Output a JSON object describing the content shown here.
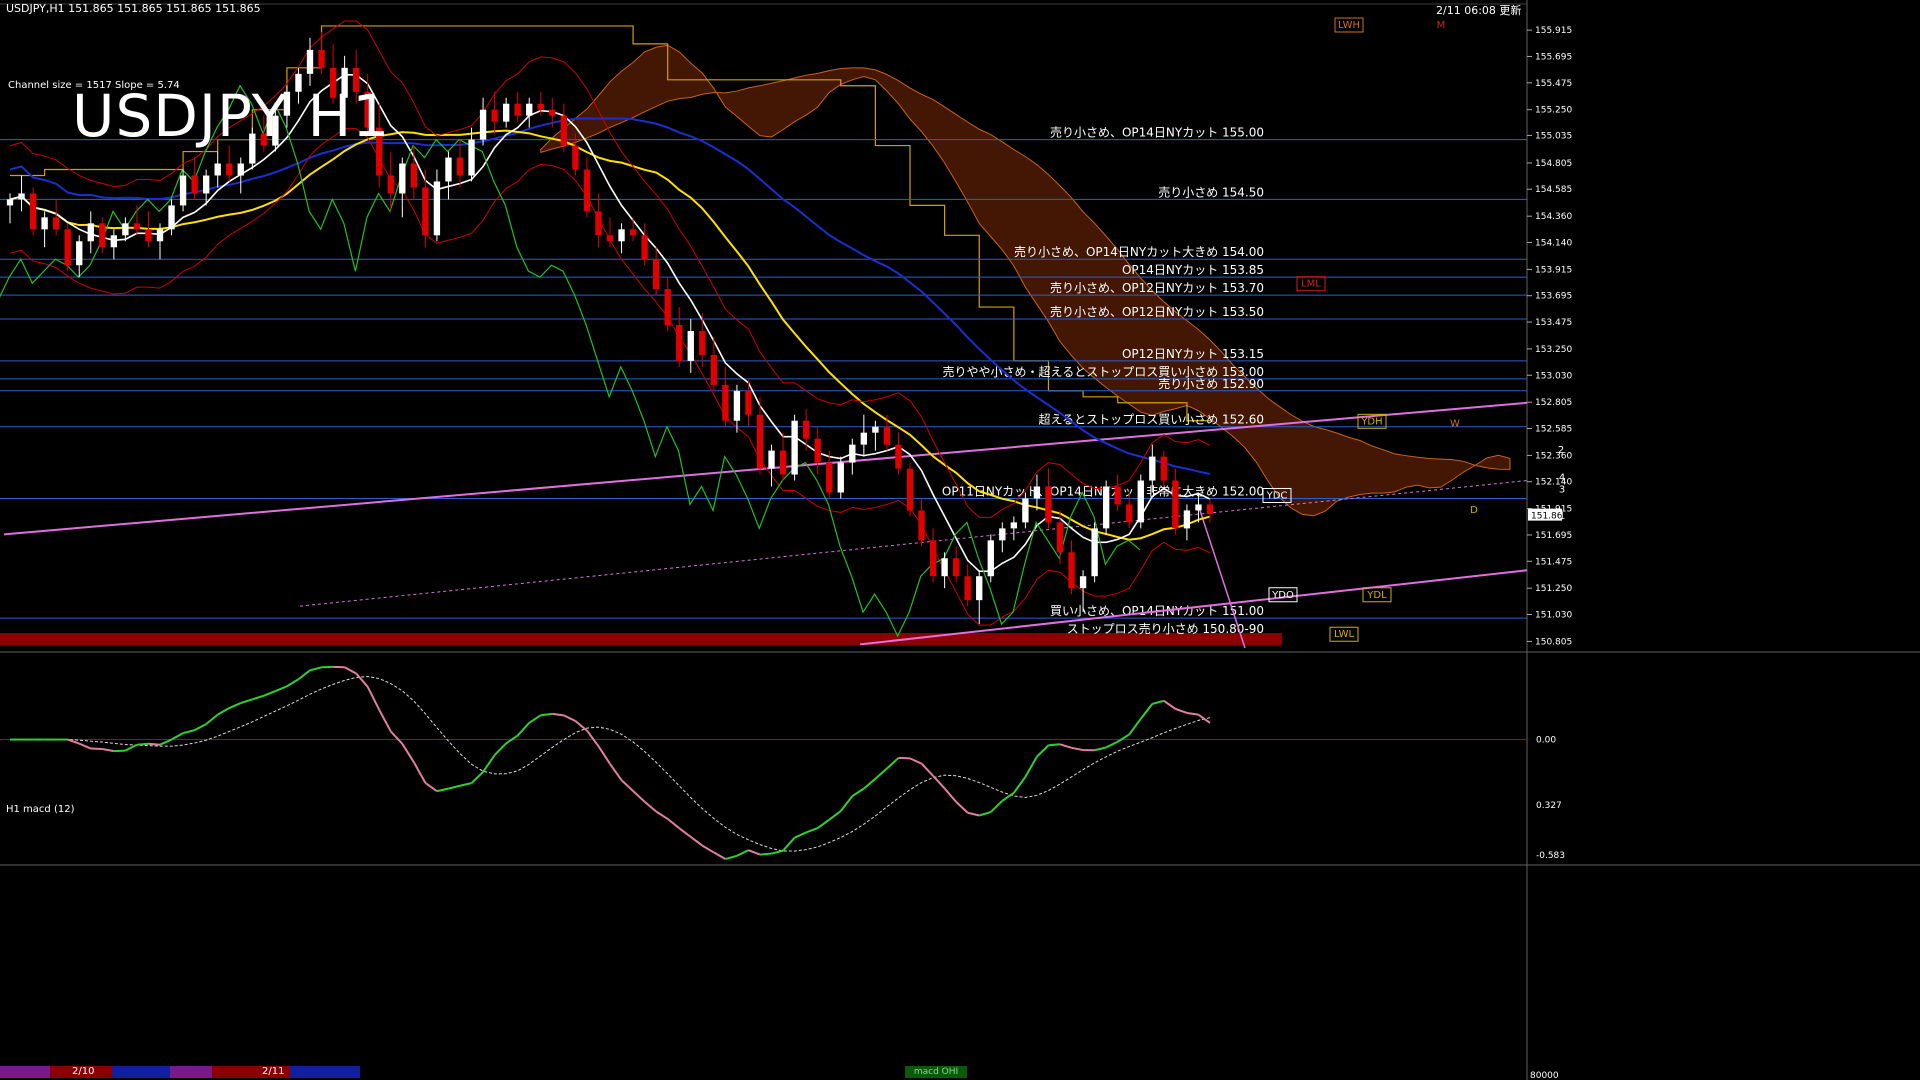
{
  "header": {
    "symbol_info": "USDJPY,H1  151.865 151.865 151.865 151.865",
    "datetime": "2/11 06:08",
    "suffix": "更新",
    "title": "USDJPY H1",
    "channel_info": "Channel size = 1517 Slope = 5.74"
  },
  "macd": {
    "label": "H1  macd (12)",
    "scale_top": "0.327",
    "scale_zero": "0.00",
    "scale_bottom": "-0.583",
    "volume_label": "80000"
  },
  "timeline": {
    "dates": [
      "2/10",
      "2/11"
    ],
    "tab_label": "macd OHI"
  },
  "colors": {
    "bull": "#ffffff",
    "bear": "#e00000",
    "sma_short": "#ffffff",
    "sma_mid": "#ffe000",
    "sma_long": "#1830d0",
    "bands": "#d00000",
    "chikou": "#22c022",
    "cloud": "#c86418",
    "kijun": "#d4a000",
    "levels": "#2860d0",
    "trend": "#e070e0",
    "macd_up": "#30d030",
    "macd_down": "#e080a0"
  },
  "chart_data": {
    "type": "candlestick",
    "y_ticks": [
      "155.915",
      "155.695",
      "155.475",
      "155.250",
      "155.035",
      "154.805",
      "154.585",
      "154.360",
      "154.140",
      "153.915",
      "153.695",
      "153.475",
      "153.250",
      "153.030",
      "152.805",
      "152.585",
      "152.360",
      "152.140",
      "151.915",
      "151.695",
      "151.475",
      "151.250",
      "151.030",
      "150.805"
    ],
    "ylim": [
      150.75,
      156.05
    ],
    "current_price": "151.865",
    "levels": [
      {
        "price": 155.0,
        "label": "売り小さめ、OP14日NYカット 155.00"
      },
      {
        "price": 154.5,
        "label": "売り小さめ 154.50"
      },
      {
        "price": 154.0,
        "label": "売り小さめ、OP14日NYカット大きめ 154.00"
      },
      {
        "price": 153.85,
        "label": "OP14日NYカット 153.85"
      },
      {
        "price": 153.7,
        "label": "売り小さめ、OP12日NYカット 153.70"
      },
      {
        "price": 153.5,
        "label": "売り小さめ、OP12日NYカット 153.50"
      },
      {
        "price": 153.15,
        "label": "OP12日NYカット 153.15"
      },
      {
        "price": 153.0,
        "label": "売りやや小さめ・超えるとストップロス買い小さめ 153.00"
      },
      {
        "price": 152.9,
        "label": "売り小さめ 152.90"
      },
      {
        "price": 152.6,
        "label": "超えるとストップロス買い小さめ 152.60"
      },
      {
        "price": 152.0,
        "label": "OP11日NYカット、OP14日NYカット非常に大きめ 152.00"
      },
      {
        "price": 151.0,
        "label": "買い小さめ、OP14日NYカット 151.00"
      },
      {
        "price": 150.85,
        "label": "ストップロス売り小さめ 150.80-90"
      }
    ],
    "markers": [
      "LWH",
      "M",
      "LML",
      "YDH",
      "W",
      "YDC",
      "YDO",
      "YDL",
      "LWL",
      "D",
      "2",
      "4",
      "3",
      "1"
    ],
    "candles": [
      [
        154.45,
        154.55,
        154.3,
        154.5
      ],
      [
        154.5,
        154.7,
        154.4,
        154.55
      ],
      [
        154.55,
        154.6,
        154.2,
        154.25
      ],
      [
        154.25,
        154.4,
        154.1,
        154.35
      ],
      [
        154.35,
        154.5,
        154.2,
        154.25
      ],
      [
        154.25,
        154.3,
        153.9,
        153.95
      ],
      [
        153.95,
        154.2,
        153.85,
        154.15
      ],
      [
        154.15,
        154.4,
        154.05,
        154.3
      ],
      [
        154.3,
        154.35,
        154.05,
        154.1
      ],
      [
        154.1,
        154.25,
        154.0,
        154.2
      ],
      [
        154.2,
        154.35,
        154.15,
        154.3
      ],
      [
        154.3,
        154.45,
        154.2,
        154.25
      ],
      [
        154.25,
        154.4,
        154.1,
        154.15
      ],
      [
        154.15,
        154.3,
        154.0,
        154.25
      ],
      [
        154.25,
        154.5,
        154.2,
        154.45
      ],
      [
        154.45,
        154.75,
        154.4,
        154.7
      ],
      [
        154.7,
        154.85,
        154.5,
        154.55
      ],
      [
        154.55,
        154.75,
        154.45,
        154.7
      ],
      [
        154.7,
        154.9,
        154.6,
        154.8
      ],
      [
        154.8,
        154.95,
        154.65,
        154.7
      ],
      [
        154.7,
        154.85,
        154.55,
        154.8
      ],
      [
        154.8,
        155.1,
        154.75,
        155.05
      ],
      [
        155.05,
        155.2,
        154.9,
        154.95
      ],
      [
        154.95,
        155.25,
        154.9,
        155.2
      ],
      [
        155.2,
        155.45,
        155.1,
        155.4
      ],
      [
        155.4,
        155.6,
        155.3,
        155.55
      ],
      [
        155.55,
        155.85,
        155.45,
        155.75
      ],
      [
        155.75,
        155.9,
        155.55,
        155.6
      ],
      [
        155.6,
        155.8,
        155.3,
        155.35
      ],
      [
        155.35,
        155.7,
        155.25,
        155.6
      ],
      [
        155.6,
        155.75,
        155.3,
        155.4
      ],
      [
        155.4,
        155.55,
        155.05,
        155.1
      ],
      [
        155.1,
        155.3,
        154.6,
        154.7
      ],
      [
        154.7,
        154.9,
        154.4,
        154.55
      ],
      [
        154.55,
        154.85,
        154.35,
        154.8
      ],
      [
        154.8,
        154.95,
        154.5,
        154.6
      ],
      [
        154.6,
        154.75,
        154.1,
        154.2
      ],
      [
        154.2,
        154.75,
        154.15,
        154.65
      ],
      [
        154.65,
        154.9,
        154.5,
        154.85
      ],
      [
        154.85,
        155.0,
        154.6,
        154.7
      ],
      [
        154.7,
        155.1,
        154.65,
        155.0
      ],
      [
        155.0,
        155.35,
        154.95,
        155.25
      ],
      [
        155.25,
        155.4,
        155.05,
        155.15
      ],
      [
        155.15,
        155.35,
        155.1,
        155.3
      ],
      [
        155.3,
        155.4,
        155.15,
        155.2
      ],
      [
        155.2,
        155.35,
        155.1,
        155.3
      ],
      [
        155.3,
        155.4,
        155.2,
        155.25
      ],
      [
        155.25,
        155.35,
        155.1,
        155.2
      ],
      [
        155.2,
        155.3,
        154.9,
        154.95
      ],
      [
        154.95,
        155.05,
        154.7,
        154.75
      ],
      [
        154.75,
        154.85,
        154.35,
        154.4
      ],
      [
        154.4,
        154.55,
        154.1,
        154.2
      ],
      [
        154.2,
        154.35,
        154.1,
        154.15
      ],
      [
        154.15,
        154.3,
        154.05,
        154.25
      ],
      [
        154.25,
        154.35,
        154.15,
        154.2
      ],
      [
        154.2,
        154.3,
        153.95,
        154.0
      ],
      [
        154.0,
        154.1,
        153.7,
        153.75
      ],
      [
        153.75,
        153.85,
        153.4,
        153.45
      ],
      [
        153.45,
        153.6,
        153.1,
        153.15
      ],
      [
        153.15,
        153.5,
        153.05,
        153.4
      ],
      [
        153.4,
        153.55,
        153.1,
        153.2
      ],
      [
        153.2,
        153.35,
        152.9,
        152.95
      ],
      [
        152.95,
        153.1,
        152.6,
        152.65
      ],
      [
        152.65,
        152.95,
        152.55,
        152.9
      ],
      [
        152.9,
        153.0,
        152.6,
        152.7
      ],
      [
        152.7,
        152.85,
        152.2,
        152.25
      ],
      [
        152.25,
        152.45,
        152.1,
        152.4
      ],
      [
        152.4,
        152.55,
        152.15,
        152.2
      ],
      [
        152.2,
        152.7,
        152.15,
        152.65
      ],
      [
        152.65,
        152.75,
        152.4,
        152.5
      ],
      [
        152.5,
        152.6,
        152.2,
        152.3
      ],
      [
        152.3,
        152.4,
        152.0,
        152.05
      ],
      [
        152.05,
        152.35,
        152.0,
        152.3
      ],
      [
        152.3,
        152.5,
        152.2,
        152.45
      ],
      [
        152.45,
        152.7,
        152.35,
        152.55
      ],
      [
        152.55,
        152.65,
        152.4,
        152.6
      ],
      [
        152.6,
        152.7,
        152.4,
        152.45
      ],
      [
        152.45,
        152.55,
        152.2,
        152.25
      ],
      [
        152.25,
        152.3,
        151.85,
        151.9
      ],
      [
        151.9,
        152.0,
        151.6,
        151.65
      ],
      [
        151.65,
        151.75,
        151.3,
        151.35
      ],
      [
        151.35,
        151.55,
        151.25,
        151.5
      ],
      [
        151.5,
        151.6,
        151.3,
        151.35
      ],
      [
        151.35,
        151.45,
        151.1,
        151.15
      ],
      [
        151.15,
        151.4,
        150.95,
        151.35
      ],
      [
        151.35,
        151.7,
        151.3,
        151.65
      ],
      [
        151.65,
        151.8,
        151.55,
        151.75
      ],
      [
        151.75,
        151.85,
        151.65,
        151.8
      ],
      [
        151.8,
        152.05,
        151.75,
        152.0
      ],
      [
        152.0,
        152.2,
        151.9,
        152.1
      ],
      [
        152.1,
        152.25,
        151.75,
        151.8
      ],
      [
        151.8,
        151.9,
        151.45,
        151.55
      ],
      [
        151.55,
        151.65,
        151.2,
        151.25
      ],
      [
        151.25,
        151.4,
        151.05,
        151.35
      ],
      [
        151.35,
        151.8,
        151.3,
        151.75
      ],
      [
        151.75,
        152.15,
        151.7,
        152.1
      ],
      [
        152.1,
        152.2,
        151.9,
        151.95
      ],
      [
        151.95,
        152.05,
        151.75,
        151.8
      ],
      [
        151.8,
        152.2,
        151.75,
        152.15
      ],
      [
        152.15,
        152.45,
        152.05,
        152.35
      ],
      [
        152.35,
        152.4,
        152.1,
        152.15
      ],
      [
        152.15,
        152.25,
        151.7,
        151.75
      ],
      [
        151.75,
        151.95,
        151.65,
        151.9
      ],
      [
        151.9,
        152.05,
        151.8,
        151.95
      ],
      [
        151.95,
        152.0,
        151.8,
        151.87
      ]
    ]
  }
}
